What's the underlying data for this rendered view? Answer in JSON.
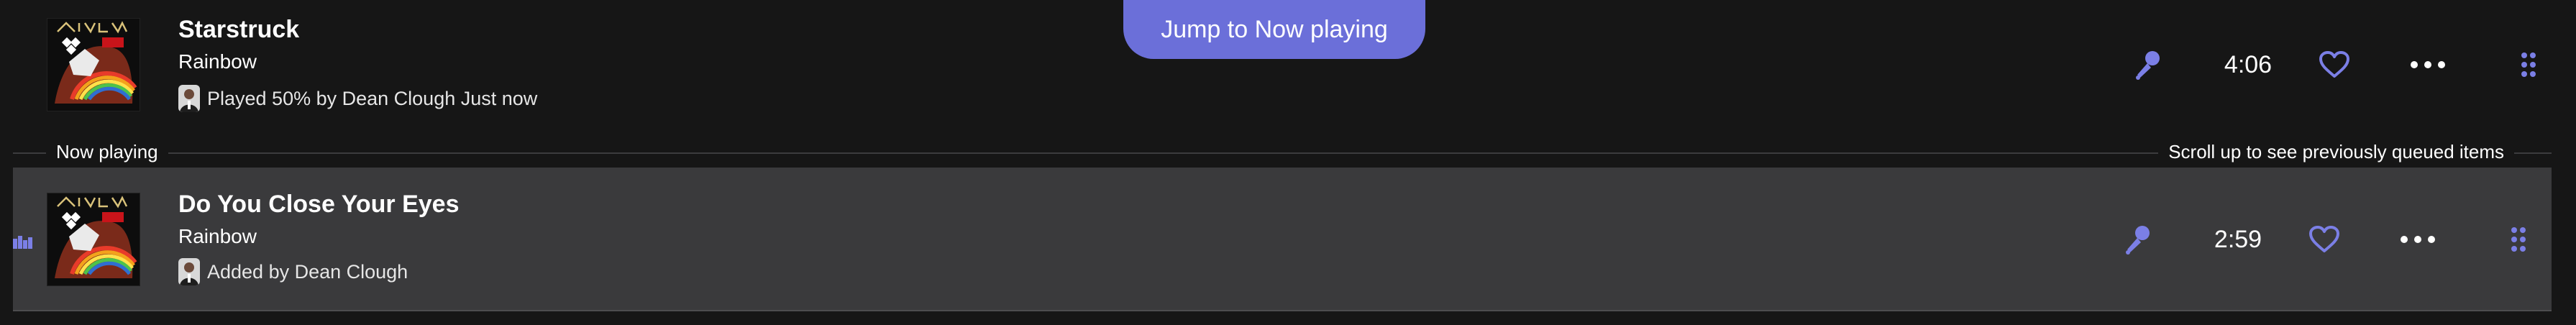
{
  "jump_button": {
    "label": "Jump to Now playing"
  },
  "queue": {
    "previous": {
      "title": "Starstruck",
      "artist": "Rainbow",
      "meta_text": "Played 50% by Dean Clough Just now",
      "duration": "4:06"
    },
    "divider": {
      "left_label": "Now playing",
      "right_label": "Scroll up to see previously queued items"
    },
    "current": {
      "title": "Do You Close Your Eyes",
      "artist": "Rainbow",
      "meta_text": "Added by Dean Clough",
      "duration": "2:59"
    }
  },
  "colors": {
    "accent": "#6b6fd9",
    "row_highlight": "#3a3a3c",
    "background": "#161616"
  },
  "icons": {
    "mic": "microphone-icon",
    "heart": "heart-icon",
    "more": "more-options-icon",
    "drag": "drag-handle-icon",
    "playing": "now-playing-bars-icon"
  }
}
